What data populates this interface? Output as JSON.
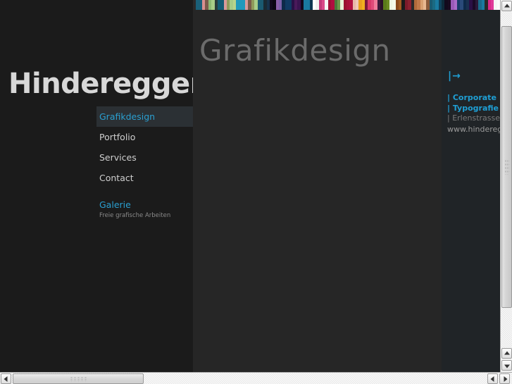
{
  "brand": {
    "name": "Hinderegger"
  },
  "page": {
    "title": "Grafikdesign"
  },
  "nav": {
    "items": [
      {
        "label": "Grafikdesign",
        "active": true
      },
      {
        "label": "Portfolio",
        "active": false
      },
      {
        "label": "Services",
        "active": false
      },
      {
        "label": "Contact",
        "active": false
      }
    ],
    "gallery": {
      "label": "Galerie",
      "sublabel": "Freie grafische Arbeiten"
    }
  },
  "info_panel": {
    "toggle_icon": "|→",
    "lines": [
      {
        "text": "| Corporate",
        "style": "strong"
      },
      {
        "text": "| Typografie",
        "style": "strong"
      },
      {
        "text": "| Erlenstrasse",
        "style": "muted"
      },
      {
        "text": "www.hinderegg",
        "style": "url"
      }
    ]
  },
  "colors": {
    "accent": "#2a9fd0",
    "page_bg": "#1b1b1b",
    "content_bg": "#262626",
    "panel_bg": "#202427",
    "title_text": "#6b6b6b",
    "nav_text": "#cfcfcf"
  },
  "stripe_bar": {
    "stripes": [
      "#2a2a2a",
      "#1a6079",
      "#1a6079",
      "#d98f8f",
      "#7a5a4a",
      "#8fba74",
      "#a8cc88",
      "#2a3a3a",
      "#135a73",
      "#135a73",
      "#d99a9a",
      "#8f9a5a",
      "#a8cc88",
      "#b8d48c",
      "#2299bb",
      "#2299bb",
      "#2299bb",
      "#d99a9a",
      "#7a5a4a",
      "#8f9a5a",
      "#a8cc88",
      "#1a5a70",
      "#1a5a70",
      "#1a2a33",
      "#17324a",
      "#120a1c",
      "#0b0612",
      "#8a5fa8",
      "#7a5fa8",
      "#0d2a4a",
      "#103a63",
      "#103a63",
      "#2a1046",
      "#4a1a5a",
      "#3a1450",
      "#120a1c",
      "#1a7aa0",
      "#1a7aa0",
      "#0d3550",
      "#ffffff",
      "#f0f0f0",
      "#c23a7a",
      "#d94a8a",
      "#f5f5f5",
      "#a01038",
      "#b01040",
      "#4a7a3a",
      "#6a9a4a",
      "#e8f0d8",
      "#9a1030",
      "#a81038",
      "#b01040",
      "#e8b8a8",
      "#f0c8b8",
      "#e8a020",
      "#f0b020",
      "#7a1a3a",
      "#d93a6a",
      "#e04a7a",
      "#f07a9a",
      "#3a1a3a",
      "#2a1028",
      "#5a7a1a",
      "#6a8a20",
      "#eef5e0",
      "#f5fae8",
      "#8a4a1a",
      "#a05a20",
      "#1a1a1a",
      "#7a1a2a",
      "#8a2030",
      "#2a2a2a",
      "#b06a3a",
      "#c07a4a",
      "#d9a070",
      "#e8b890",
      "#8a5a3a",
      "#1a5a70",
      "#1a6a82",
      "#1a7aa0",
      "#10405a",
      "#0d2a3a",
      "#120a1c",
      "#1a0a20",
      "#9a5ab8",
      "#aa6ac8",
      "#1a3a6a",
      "#2a4a7a",
      "#0d2a4a",
      "#1a3050",
      "#2a1046",
      "#1a0a28",
      "#2a1a3a",
      "#1a6a8a",
      "#1a7aa0",
      "#2a2a2a",
      "#d92a8a",
      "#e03a9a",
      "#f5f5f5",
      "#fafafa"
    ]
  },
  "scrollbars": {
    "vertical": {
      "up_arrow": "▲",
      "down_arrow": "▼"
    },
    "horizontal": {
      "left_arrow": "◀",
      "right_arrow": "▶"
    }
  }
}
